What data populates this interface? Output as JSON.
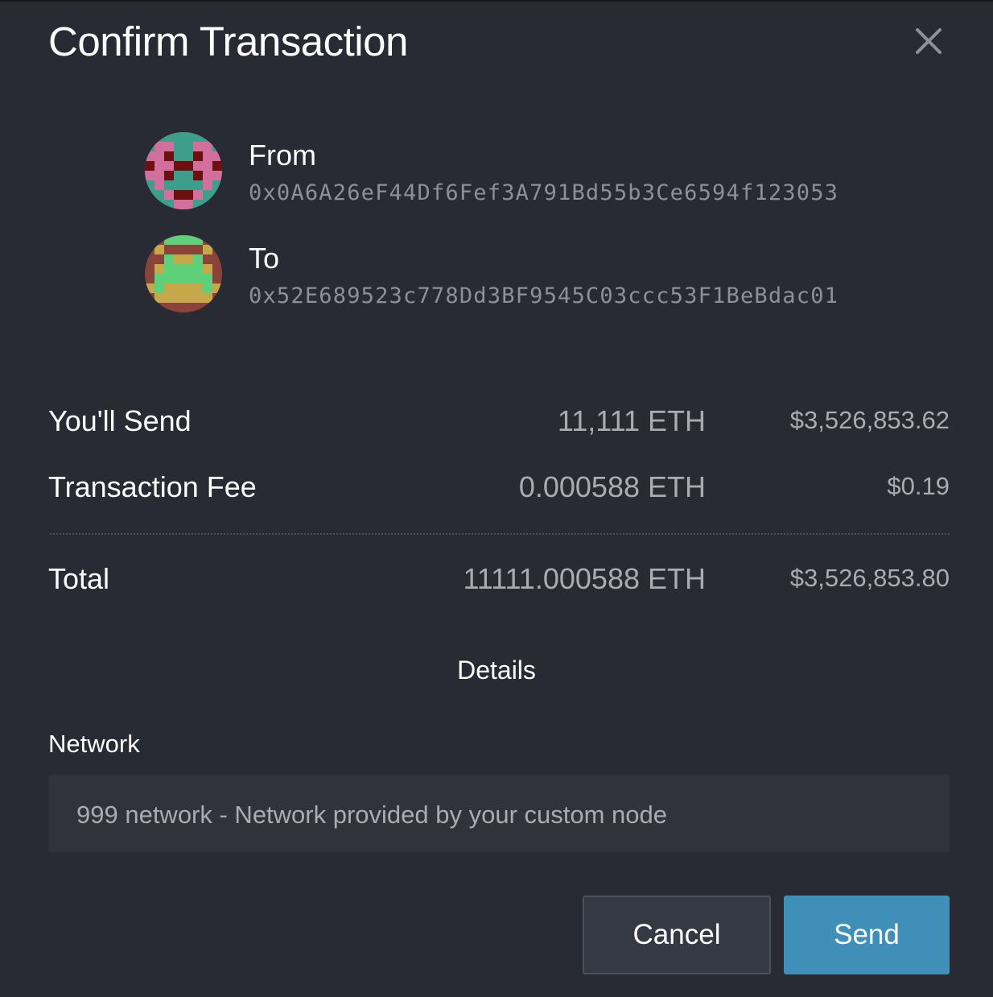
{
  "dialog": {
    "title": "Confirm Transaction",
    "close_icon": "close-icon"
  },
  "from": {
    "label": "From",
    "address": "0x0A6A26eF44Df6Fef3A791Bd55b3Ce6594f123053",
    "avatar_icon": "identicon-avatar",
    "avatar_colors": [
      "#3e9e8c",
      "#d26f9d",
      "#6e1010"
    ]
  },
  "to": {
    "label": "To",
    "address": "0x52E689523c778Dd3BF9545C03ccc53F1BeBdac01",
    "avatar_icon": "identicon-avatar",
    "avatar_colors": [
      "#8a4338",
      "#5fd07a",
      "#c4a84a"
    ]
  },
  "summary": {
    "send": {
      "label": "You'll Send",
      "amount": "11,111 ETH",
      "fiat": "$3,526,853.62"
    },
    "fee": {
      "label": "Transaction Fee",
      "amount": "0.000588 ETH",
      "fiat": "$0.19"
    },
    "total": {
      "label": "Total",
      "amount": "11111.000588 ETH",
      "fiat": "$3,526,853.80"
    }
  },
  "details": {
    "label": "Details"
  },
  "network": {
    "label": "Network",
    "value": "999 network - Network provided by your custom node"
  },
  "actions": {
    "cancel_label": "Cancel",
    "send_label": "Send"
  },
  "colors": {
    "background": "#282b33",
    "field_background": "#30333c",
    "primary_button": "#3f8fb8",
    "secondary_button": "#353944",
    "muted_text": "#a9acb2",
    "address_text": "#8d9098"
  }
}
